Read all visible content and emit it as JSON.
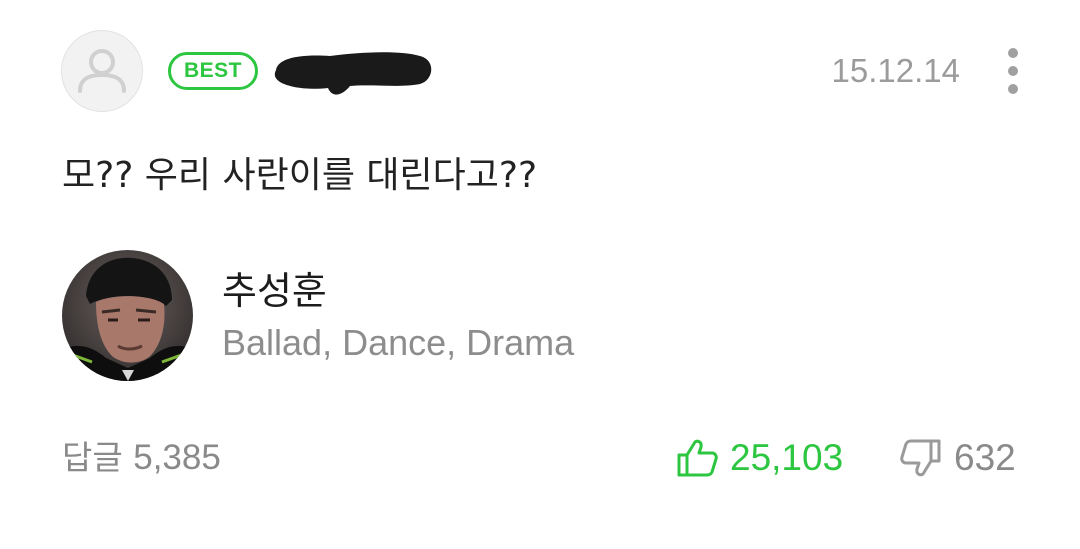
{
  "comment": {
    "badge": "BEST",
    "date": "15.12.14",
    "text": "모?? 우리 사란이를 대린다고??",
    "icons": {
      "avatar": "default-user-avatar-icon",
      "more": "more-vertical-icon",
      "like": "thumbs-up-icon",
      "dislike": "thumbs-down-icon"
    }
  },
  "artist": {
    "name": "추성훈",
    "genres": "Ballad, Dance, Drama"
  },
  "footer": {
    "reply_label": "답글",
    "reply_count": "5,385",
    "like_count": "25,103",
    "dislike_count": "632"
  },
  "colors": {
    "accent_green": "#2dc640",
    "meta_gray": "#9b9b9b",
    "text_dark": "#222222"
  }
}
